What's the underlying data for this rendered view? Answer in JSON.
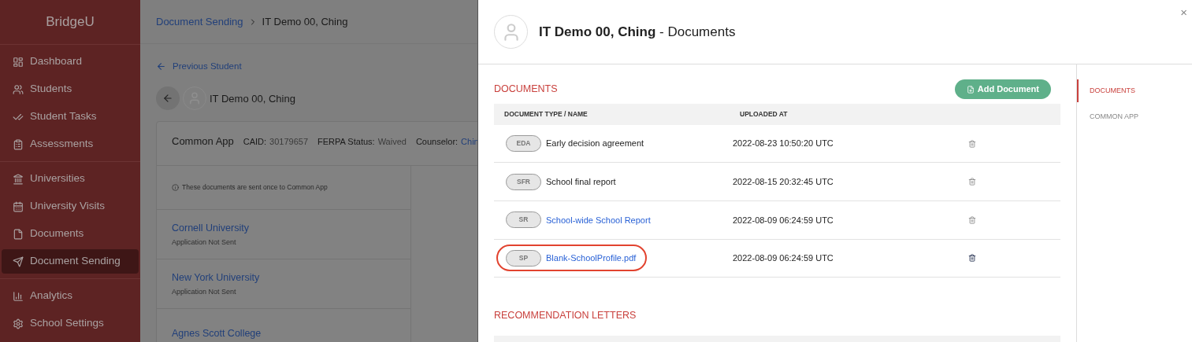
{
  "sidebar": {
    "logo": "BridgeU",
    "groups": [
      [
        {
          "label": "Dashboard",
          "kind": "dashboard",
          "selected": false
        },
        {
          "label": "Students",
          "kind": "students",
          "selected": false
        },
        {
          "label": "Student Tasks",
          "kind": "tasks",
          "selected": false
        },
        {
          "label": "Assessments",
          "kind": "assessments",
          "selected": false
        }
      ],
      [
        {
          "label": "Universities",
          "kind": "universities",
          "selected": false
        },
        {
          "label": "University Visits",
          "kind": "visits",
          "selected": false
        },
        {
          "label": "Documents",
          "kind": "documents",
          "selected": false
        },
        {
          "label": "Document Sending",
          "kind": "sending",
          "selected": true
        }
      ],
      [
        {
          "label": "Analytics",
          "kind": "analytics",
          "selected": false
        },
        {
          "label": "School Settings",
          "kind": "settings",
          "selected": false
        }
      ]
    ]
  },
  "breadcrumb": {
    "parent": "Document Sending",
    "current": "IT Demo 00, Ching"
  },
  "previous_link": "Previous Student",
  "student_name": "IT Demo 00, Ching",
  "card": {
    "title": "Common App",
    "fields": [
      {
        "label": "CAID:",
        "value": "30179657",
        "kind": "text"
      },
      {
        "label": "FERPA Status:",
        "value": "Waived",
        "kind": "text"
      },
      {
        "label": "Counselor:",
        "value": "Chin",
        "kind": "link"
      }
    ],
    "notice": "These documents are sent once to Common App",
    "universities": [
      {
        "name": "Cornell University",
        "status": "Application Not Sent"
      },
      {
        "name": "New York University",
        "status": "Application Not Sent"
      },
      {
        "name": "Agnes Scott College"
      }
    ]
  },
  "drawer": {
    "student": "IT Demo 00, Ching",
    "title_suffix": "- Documents",
    "close": "×",
    "section_title": "DOCUMENTS",
    "add_button": "Add Document",
    "columns": [
      "DOCUMENT TYPE / NAME",
      "UPLOADED AT"
    ],
    "rows": [
      {
        "tag": "EDA",
        "name": "Early decision agreement",
        "kind": "text",
        "uploaded": "2022-08-23 10:50:20 UTC",
        "highlighted": false
      },
      {
        "tag": "SFR",
        "name": "School final report",
        "kind": "text",
        "uploaded": "2022-08-15 20:32:45 UTC",
        "highlighted": false
      },
      {
        "tag": "SR",
        "name": "School-wide School Report",
        "kind": "link",
        "uploaded": "2022-08-09 06:24:59 UTC",
        "highlighted": false
      },
      {
        "tag": "SP",
        "name": "Blank-SchoolProfile.pdf",
        "kind": "link",
        "uploaded": "2022-08-09 06:24:59 UTC",
        "highlighted": true
      }
    ],
    "next_section": "RECOMMENDATION LETTERS",
    "nav": [
      {
        "label": "DOCUMENTS",
        "selected": true
      },
      {
        "label": "COMMON APP",
        "selected": false
      }
    ]
  }
}
